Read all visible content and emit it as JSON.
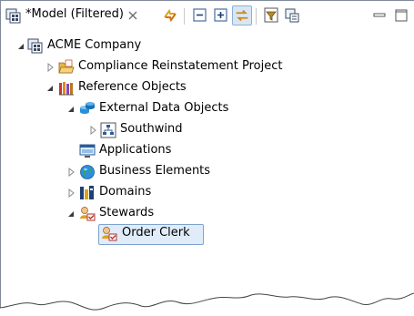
{
  "tab": {
    "title": "*Model (Filtered)",
    "close_icon": "close-icon"
  },
  "toolbar": {
    "buttons": [
      "sync-icon",
      "collapse-all-icon",
      "expand-all-icon",
      "link-with-editor-icon",
      "filter-icon",
      "view-menu-icon",
      "minimize-icon",
      "maximize-icon"
    ]
  },
  "tree": {
    "root": {
      "label": "ACME Company",
      "icon": "model-icon"
    },
    "compliance": {
      "label": "Compliance Reinstatement Project",
      "icon": "folder-open-icon"
    },
    "reference": {
      "label": "Reference Objects",
      "icon": "books-icon"
    },
    "external": {
      "label": "External Data Objects",
      "icon": "database-icon"
    },
    "southwind": {
      "label": "Southwind",
      "icon": "schema-icon"
    },
    "applications": {
      "label": "Applications",
      "icon": "application-icon"
    },
    "business": {
      "label": "Business Elements",
      "icon": "globe-icon"
    },
    "domains": {
      "label": "Domains",
      "icon": "domain-icon"
    },
    "stewards": {
      "label": "Stewards",
      "icon": "stewards-icon"
    },
    "orderclerk": {
      "label": "Order Clerk",
      "icon": "steward-icon"
    }
  },
  "colors": {
    "selection_fill": "#e0ecfa",
    "selection_border": "#7da2ce"
  }
}
